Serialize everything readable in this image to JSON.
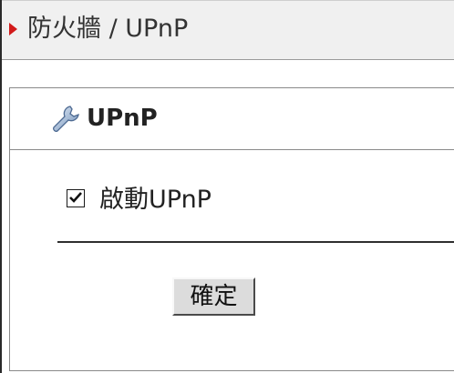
{
  "header": {
    "title": "防火牆 / UPnP"
  },
  "panel": {
    "title": "UPnP",
    "enable_upnp_label": "啟動UPnP",
    "enable_upnp_checked": true,
    "submit_label": "確定"
  },
  "icons": {
    "title_marker": "red-arrow-bullet",
    "panel_icon": "wrench-icon",
    "checkbox": "check-icon"
  },
  "colors": {
    "title_marker": "#d21a1a",
    "title_bar_background": "#f0f0f0",
    "button_background": "#dcdcdc"
  }
}
